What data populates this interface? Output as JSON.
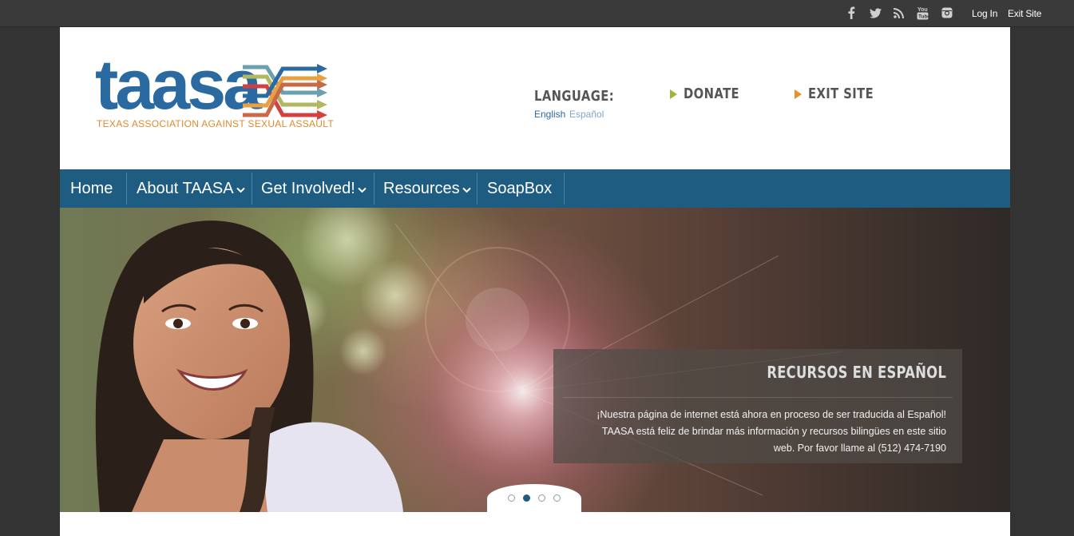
{
  "topbar": {
    "icons": [
      "facebook-icon",
      "twitter-icon",
      "rss-icon",
      "youtube-icon",
      "instagram-icon"
    ],
    "login": "Log In",
    "exit": "Exit Site"
  },
  "logo": {
    "wordmark": "taasa",
    "tagline": "TEXAS ASSOCIATION AGAINST SEXUAL ASSAULT",
    "arrow_colors": [
      "#2a6aa0",
      "#e8a040",
      "#6aa0b0",
      "#b0b860",
      "#c86a48",
      "#d44040"
    ]
  },
  "header": {
    "language_label": "LANGUAGE:",
    "lang_english": "English",
    "lang_spanish": "Español",
    "donate": "DONATE",
    "exit_site": "EXIT SITE",
    "donate_arrow_color": "#9bb83a",
    "exit_arrow_color": "#e8902a"
  },
  "nav": {
    "items": [
      {
        "label": "Home",
        "dropdown": false
      },
      {
        "label": "About TAASA",
        "dropdown": true
      },
      {
        "label": "Get Involved!",
        "dropdown": true
      },
      {
        "label": "Resources",
        "dropdown": true
      },
      {
        "label": "SoapBox",
        "dropdown": false
      }
    ],
    "color": "#1e5c82"
  },
  "slider": {
    "caption_title": "RECURSOS EN ESPAÑOL",
    "caption_body_1": "¡Nuestra página de internet está ahora en proceso de ser traducida al Español!",
    "caption_body_2": "TAASA está feliz de brindar más información y recursos bilingües en este sitio",
    "caption_body_3": "web. Por favor llame al (512) 474-7190",
    "slide_count": 4,
    "active_slide": 2
  }
}
